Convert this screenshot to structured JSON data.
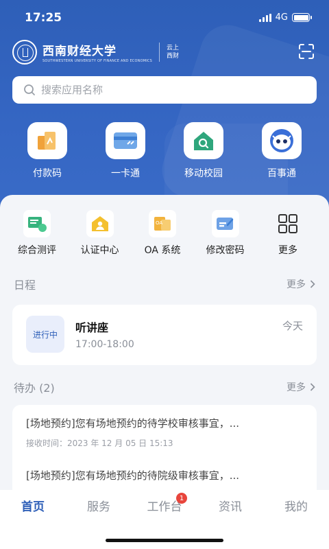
{
  "status": {
    "time": "17:25",
    "network": "4G"
  },
  "brand": {
    "name": "西南财经大学",
    "subtitle": "SOUTHWESTERN UNIVERSITY OF FINANCE AND ECONOMICS",
    "tag_line1": "云上",
    "tag_line2": "西财"
  },
  "search": {
    "placeholder": "搜索应用名称"
  },
  "quick_actions": [
    {
      "label": "付款码",
      "icon": "payment-code-icon"
    },
    {
      "label": "一卡通",
      "icon": "campus-card-icon"
    },
    {
      "label": "移动校园",
      "icon": "mobile-campus-icon"
    },
    {
      "label": "百事通",
      "icon": "robot-assistant-icon"
    }
  ],
  "services": [
    {
      "label": "综合测评",
      "icon": "evaluation-icon"
    },
    {
      "label": "认证中心",
      "icon": "auth-center-icon"
    },
    {
      "label": "OA 系统",
      "icon": "oa-system-icon"
    },
    {
      "label": "修改密码",
      "icon": "change-password-icon"
    },
    {
      "label": "更多",
      "icon": "grid-more-icon"
    }
  ],
  "schedule": {
    "title": "日程",
    "more": "更多",
    "item": {
      "status": "进行中",
      "title": "听讲座",
      "time": "17:00-18:00",
      "day": "今天"
    }
  },
  "todo": {
    "title": "待办 (2)",
    "more": "更多",
    "items": [
      {
        "text": "[场地预约]您有场地预约的待学校审核事宜，...",
        "time": "接收时间：2023 年 12 月 05 日 15:13"
      },
      {
        "text": "[场地预约]您有场地预约的待院级审核事宜，...",
        "time": ""
      }
    ]
  },
  "tabbar": {
    "tabs": [
      {
        "label": "首页",
        "active": true
      },
      {
        "label": "服务"
      },
      {
        "label": "工作台",
        "badge": "1"
      },
      {
        "label": "资讯"
      },
      {
        "label": "我的"
      }
    ]
  },
  "colors": {
    "primary": "#2e5fb8",
    "accent_orange": "#f0a23a",
    "accent_green": "#2fa67c",
    "badge_red": "#e8453c"
  }
}
